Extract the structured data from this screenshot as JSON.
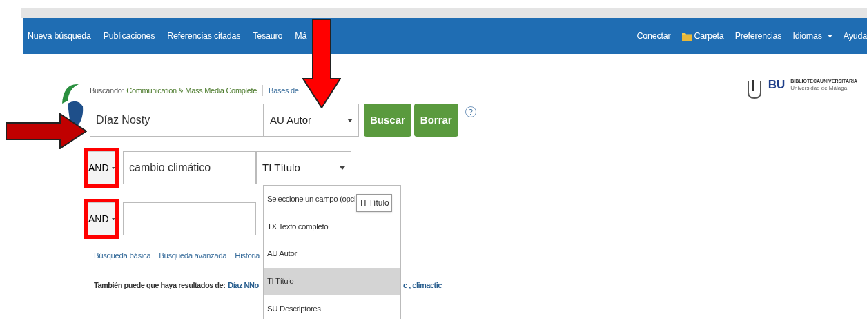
{
  "nav": {
    "left": [
      {
        "label": "Nueva búsqueda"
      },
      {
        "label": "Publicaciones"
      },
      {
        "label": "Referencias citadas"
      },
      {
        "label": "Tesauro"
      },
      {
        "label": "Má"
      }
    ],
    "right": [
      {
        "label": "Conectar",
        "kind": "link"
      },
      {
        "label": "Carpeta",
        "kind": "folder"
      },
      {
        "label": "Preferencias",
        "kind": "link"
      },
      {
        "label": "Idiomas",
        "kind": "menu"
      },
      {
        "label": "Ayuda",
        "kind": "link"
      }
    ]
  },
  "library_logo": {
    "mark": "BU",
    "name": "BIBLIOTECAUNIVERSITARIA",
    "subtitle": "Universidad de Málaga"
  },
  "search": {
    "label": "Buscando:",
    "database": "Communication & Mass Media Complete",
    "databases_link": "Bases de",
    "rows": [
      {
        "value": "Díaz Nosty",
        "field": "AU Autor"
      },
      {
        "operator": "AND",
        "highlighted": true,
        "value": "cambio climático",
        "field": "TI Título"
      },
      {
        "operator": "AND",
        "highlighted": true
      }
    ],
    "buttons": [
      "Buscar",
      "Borrar"
    ],
    "help": "?"
  },
  "links": [
    "Búsqueda básica",
    "Búsqueda avanzada",
    "Historia"
  ],
  "suggestions": {
    "label": "También puede que haya resultados de:",
    "before": "Díaz NNo",
    "after": "c , climactic"
  },
  "dropdown": {
    "items": [
      {
        "label": "Seleccione un campo (opci",
        "selected": false
      },
      {
        "label": "TX Texto completo",
        "selected": false
      },
      {
        "label": "AU Autor",
        "selected": false
      },
      {
        "label": "TI Título",
        "selected": true
      },
      {
        "label": "SU Descriptores",
        "selected": false
      }
    ],
    "tooltip": "TI Título"
  }
}
